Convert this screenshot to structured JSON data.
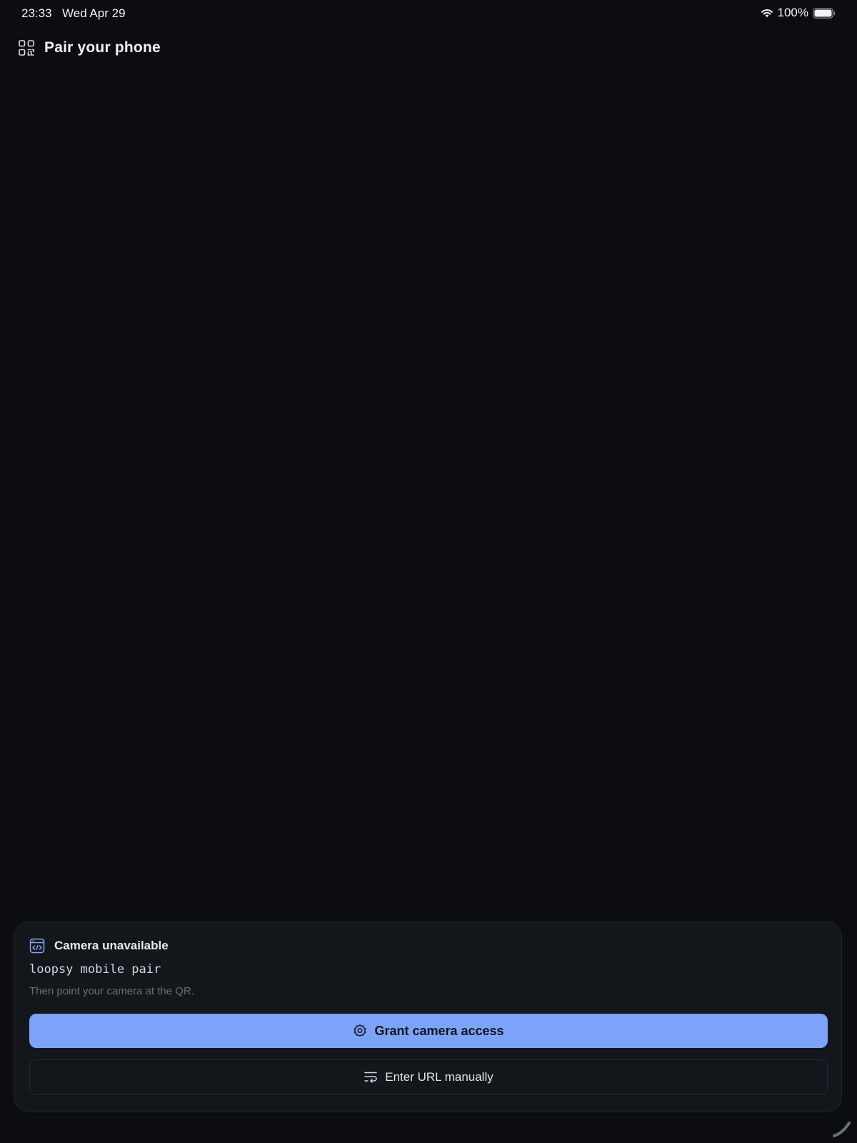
{
  "status_bar": {
    "time": "23:33",
    "date": "Wed Apr 29",
    "battery_percent": "100%",
    "battery_level": 1.0,
    "icons": [
      "wifi-icon",
      "battery-icon"
    ]
  },
  "header": {
    "icon": "qr-code-icon",
    "title": "Pair your phone"
  },
  "camera_panel": {
    "icon": "code-window-icon",
    "title": "Camera unavailable",
    "command": "loopsy mobile pair",
    "hint": "Then point your camera at the QR.",
    "grant_button": {
      "icon": "gear-icon",
      "label": "Grant camera access"
    },
    "manual_button": {
      "icon": "text-wrap-icon",
      "label": "Enter URL manually"
    }
  },
  "colors": {
    "background": "#0b0d11",
    "panel": "#13161b",
    "accent": "#7ba3f7",
    "accent_icon": "#8aa9f0"
  }
}
